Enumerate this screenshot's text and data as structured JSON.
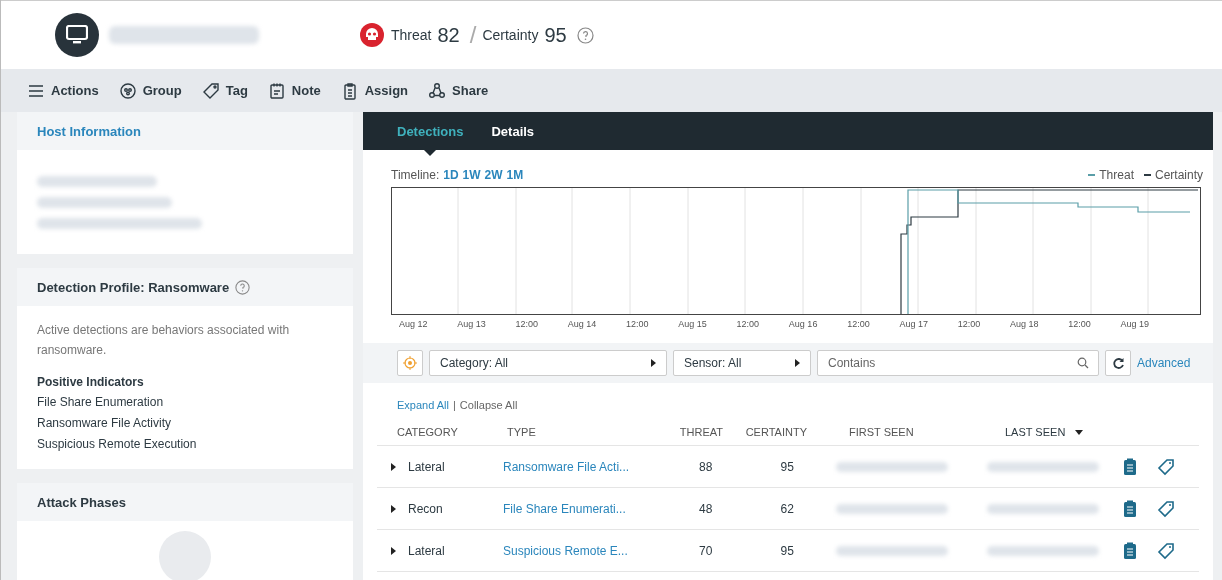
{
  "header": {
    "threat_label": "Threat",
    "threat": "82",
    "separator": "/",
    "certainty_label": "Certainty",
    "certainty": "95"
  },
  "toolbar": [
    "Actions",
    "Group",
    "Tag",
    "Note",
    "Assign",
    "Share"
  ],
  "host_information": {
    "title": "Host Information"
  },
  "detection_profile": {
    "title": "Detection Profile: Ransomware",
    "description": "Active detections are behaviors associated with ransomware.",
    "indicators_title": "Positive Indicators",
    "indicators": [
      "File Share Enumeration",
      "Ransomware File Activity",
      "Suspicious Remote Execution"
    ]
  },
  "attack_phases": {
    "title": "Attack Phases"
  },
  "tabs": [
    {
      "label": "Detections",
      "selected": true
    },
    {
      "label": "Details",
      "selected": false
    }
  ],
  "timeline": {
    "label": "Timeline:",
    "ranges": [
      "1D",
      "1W",
      "2W",
      "1M"
    ],
    "legend": [
      {
        "name": "Threat",
        "color": "#5a9ea8"
      },
      {
        "name": "Certainty",
        "color": "#2d3a42"
      }
    ],
    "axis_labels": [
      "Aug 12",
      "Aug 13",
      "12:00",
      "Aug 14",
      "12:00",
      "Aug 15",
      "12:00",
      "Aug 16",
      "12:00",
      "Aug 17",
      "12:00",
      "Aug 18",
      "12:00",
      "Aug 19"
    ]
  },
  "filters": {
    "category": "Category: All",
    "sensor": "Sensor: All",
    "search_placeholder": "Contains",
    "advanced": "Advanced"
  },
  "expand_all": "Expand All",
  "divider": "|",
  "collapse_all": "Collapse All",
  "columns": [
    {
      "label": "CATEGORY",
      "sorted": false
    },
    {
      "label": "TYPE",
      "sorted": false
    },
    {
      "label": "THREAT",
      "sorted": false
    },
    {
      "label": "CERTAINTY",
      "sorted": false
    },
    {
      "label": "FIRST SEEN",
      "sorted": false
    },
    {
      "label": "LAST SEEN",
      "sorted": true
    }
  ],
  "rows": [
    {
      "category": "Lateral",
      "type": "Ransomware File Acti...",
      "threat": "88",
      "certainty": "95"
    },
    {
      "category": "Recon",
      "type": "File Share Enumerati...",
      "threat": "48",
      "certainty": "62"
    },
    {
      "category": "Lateral",
      "type": "Suspicious Remote E...",
      "threat": "70",
      "certainty": "95"
    }
  ]
}
